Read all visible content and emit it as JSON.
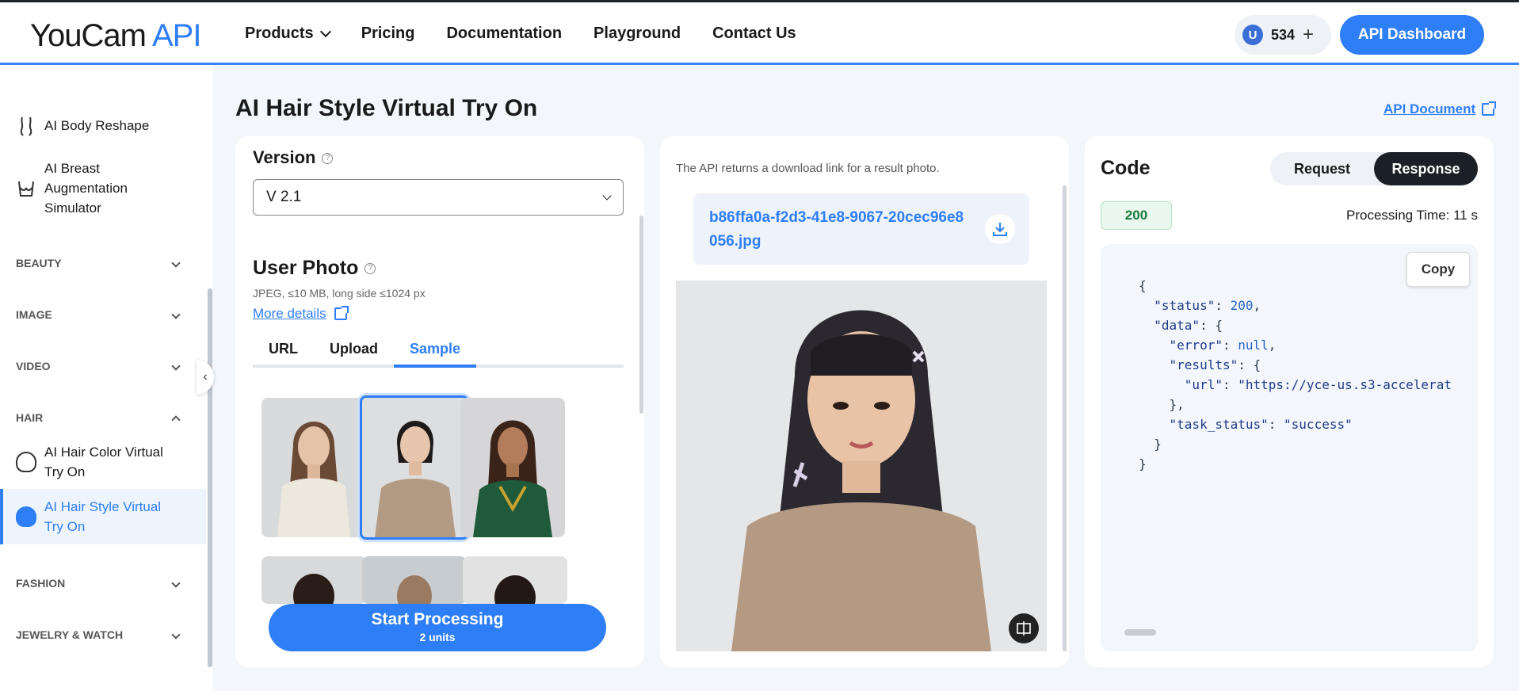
{
  "header": {
    "logo_text": "YouCam",
    "logo_api": "API",
    "nav": [
      "Products",
      "Pricing",
      "Documentation",
      "Playground",
      "Contact Us"
    ],
    "units_badge": "U",
    "units_count": "534",
    "units_plus": "+",
    "dashboard_label": "API Dashboard"
  },
  "sidebar": {
    "items_top": [
      {
        "label": "AI Body Reshape",
        "icon": "body-icon"
      },
      {
        "label": "AI Breast Augmentation Simulator",
        "icon": "torso-icon"
      }
    ],
    "sections": [
      "BEAUTY",
      "IMAGE",
      "VIDEO",
      "HAIR",
      "FASHION",
      "JEWELRY & WATCH"
    ],
    "hair_items": [
      {
        "label": "AI Hair Color Virtual Try On",
        "active": false
      },
      {
        "label": "AI Hair Style Virtual Try On",
        "active": true
      }
    ]
  },
  "page": {
    "title": "AI Hair Style Virtual Try On",
    "api_doc": "API Document"
  },
  "input_panel": {
    "version_label": "Version",
    "version_value": "V 2.1",
    "user_photo_title": "User Photo",
    "user_photo_hint": "JPEG, ≤10 MB, long side ≤1024 px",
    "more_details": "More details",
    "tabs": [
      "URL",
      "Upload",
      "Sample"
    ],
    "active_tab": "Sample",
    "start_label": "Start Processing",
    "start_units": "2 units"
  },
  "result_panel": {
    "description": "The API returns a download link for a result photo.",
    "file_name": "b86ffa0a-f2d3-41e8-9067-20cec96e8056.jpg"
  },
  "code_panel": {
    "title": "Code",
    "tabs": [
      "Request",
      "Response"
    ],
    "active_tab": "Response",
    "status_code": "200",
    "processing_time": "Processing Time: 11 s",
    "copy_label": "Copy",
    "json_lines": {
      "l1": "{",
      "l2_key": "\"status\"",
      "l2_val": "200",
      "l3_key": "\"data\"",
      "l4_key": "\"error\"",
      "l4_val": "null",
      "l5_key": "\"results\"",
      "l6_key": "\"url\"",
      "l6_val": "\"https://yce-us.s3-accelerat",
      "l7": "},",
      "l8_key": "\"task_status\"",
      "l8_val": "\"success\"",
      "l9": "}",
      "l10": "}"
    }
  },
  "colors": {
    "accent": "#2e7ef7",
    "dark": "#1a2026",
    "status_green": "#1a7a3c"
  }
}
